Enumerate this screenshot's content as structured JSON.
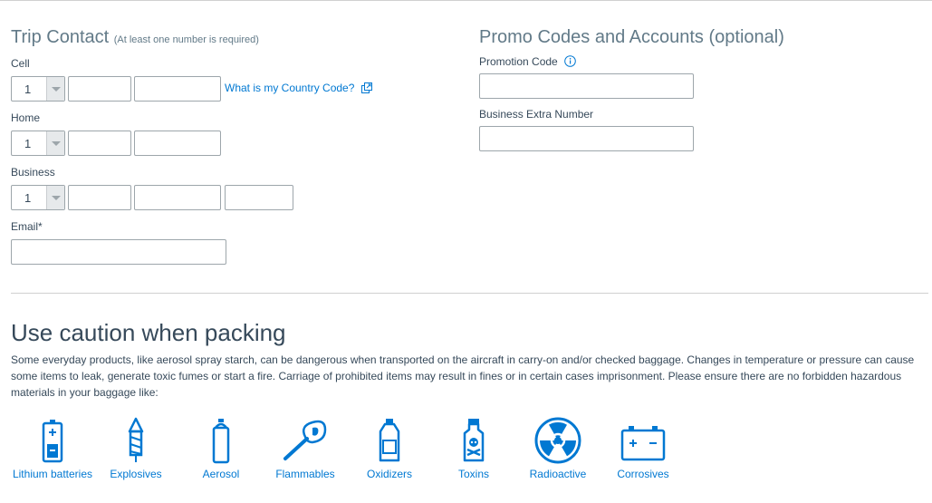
{
  "trip_contact": {
    "title": "Trip Contact",
    "note": "(At least one number is required)",
    "cell": {
      "label": "Cell",
      "country_code": "1",
      "area": "",
      "number": ""
    },
    "country_code_link": "What is my Country Code?",
    "home": {
      "label": "Home",
      "country_code": "1",
      "area": "",
      "number": ""
    },
    "business": {
      "label": "Business",
      "country_code": "1",
      "area": "",
      "number": "",
      "ext": ""
    },
    "email": {
      "label": "Email*",
      "value": ""
    }
  },
  "promo": {
    "title": "Promo Codes and Accounts (optional)",
    "promotion_code": {
      "label": "Promotion Code",
      "value": ""
    },
    "business_extra": {
      "label": "Business Extra Number",
      "value": ""
    }
  },
  "caution": {
    "title": "Use caution when packing",
    "text": "Some everyday products, like aerosol spray starch, can be dangerous when transported on the aircraft in carry-on and/or checked baggage. Changes in temperature or pressure can cause some items to leak, generate toxic fumes or start a fire. Carriage of prohibited items may result in fines or in certain cases imprisonment. Please ensure there are no forbidden hazardous materials in your baggage like:",
    "items": [
      {
        "label": "Lithium batteries",
        "icon": "battery-icon"
      },
      {
        "label": "Explosives",
        "icon": "firework-icon"
      },
      {
        "label": "Aerosol",
        "icon": "aerosol-can-icon"
      },
      {
        "label": "Flammables",
        "icon": "match-icon"
      },
      {
        "label": "Oxidizers",
        "icon": "bottle-icon"
      },
      {
        "label": "Toxins",
        "icon": "poison-bottle-icon"
      },
      {
        "label": "Radioactive",
        "icon": "radioactive-icon"
      },
      {
        "label": "Corrosives",
        "icon": "car-battery-icon"
      }
    ]
  },
  "colors": {
    "link": "#0078d2",
    "heading": "#627a88",
    "text": "#36495a",
    "border": "#9da6ab"
  }
}
